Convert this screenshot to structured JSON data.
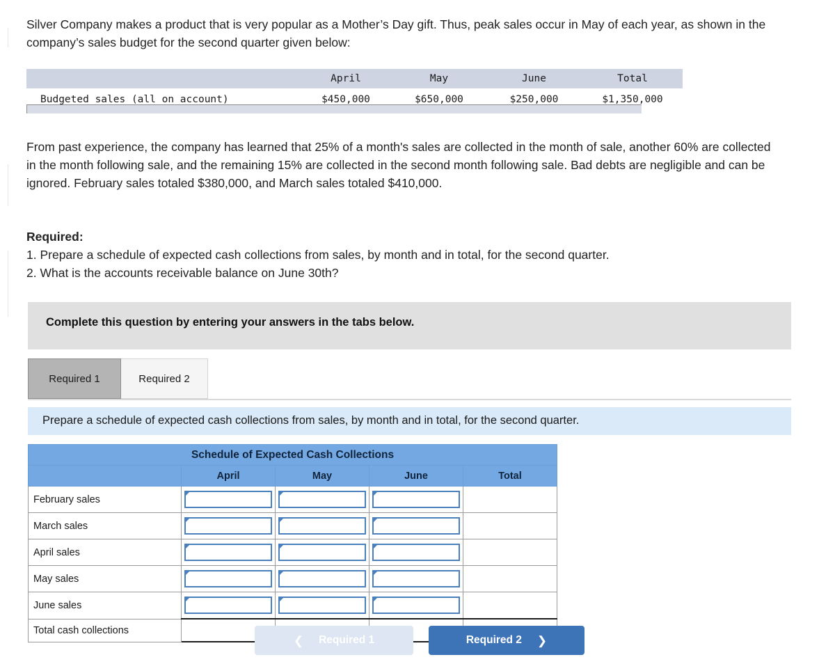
{
  "intro": {
    "paragraph": "Silver Company makes a product that is very popular as a Mother’s Day gift. Thus, peak sales occur in May of each year, as shown in the company’s sales budget for the second quarter given below:"
  },
  "exhibit": {
    "columns": [
      "",
      "April",
      "May",
      "June",
      "Total"
    ],
    "rows": [
      {
        "label": "Budgeted sales (all on account)",
        "values": [
          "$450,000",
          "$650,000",
          "$250,000",
          "$1,350,000"
        ]
      }
    ]
  },
  "body": {
    "paragraph_a": "From past experience, the company has learned that 25% of a month's sales are collected in the month of sale, another 60% are collected in the month following sale, and the remaining 15% are collected in the second month following sale. Bad debts are negligible and can be ignored. February sales totaled $380,000, and March sales totaled $410,000.",
    "required_heading": "Required:",
    "required_1": "1. Prepare a schedule of expected cash collections from sales, by month and in total, for the second quarter.",
    "required_2": "2. What is the accounts receivable balance on June 30th?"
  },
  "banner": {
    "text": "Complete this question by entering your answers in the tabs below."
  },
  "tabs": [
    {
      "label": "Required 1",
      "active": true
    },
    {
      "label": "Required 2",
      "active": false
    }
  ],
  "instruction_bar": {
    "text": "Prepare a schedule of expected cash collections from sales, by month and in total, for the second quarter."
  },
  "schedule": {
    "title": "Schedule of Expected Cash Collections",
    "columns": [
      "",
      "April",
      "May",
      "June",
      "Total"
    ],
    "rows": [
      {
        "label": "February sales",
        "april": "",
        "may": "",
        "june": "",
        "total": "",
        "input": true
      },
      {
        "label": "March sales",
        "april": "",
        "may": "",
        "june": "",
        "total": "",
        "input": true
      },
      {
        "label": "April sales",
        "april": "",
        "may": "",
        "june": "",
        "total": "",
        "input": true
      },
      {
        "label": "May sales",
        "april": "",
        "may": "",
        "june": "",
        "total": "",
        "input": true
      },
      {
        "label": "June sales",
        "april": "",
        "may": "",
        "june": "",
        "total": "",
        "input": true
      },
      {
        "label": "Total cash collections",
        "april": "",
        "may": "",
        "june": "",
        "total": "",
        "input": false
      }
    ]
  },
  "nav": {
    "prev_label": "Required 1",
    "next_label": "Required 2",
    "prev_icon": "chevron-left-icon",
    "next_icon": "chevron-right-icon"
  },
  "colors": {
    "table_header_blue": "#74a8e3",
    "instruction_blue": "#daeaf8",
    "banner_gray": "#e0e0e0",
    "primary_button": "#3d74b8",
    "disabled_button": "#dde6f2",
    "input_border": "#4a7fbd",
    "exhibit_header": "#ced4e1"
  }
}
